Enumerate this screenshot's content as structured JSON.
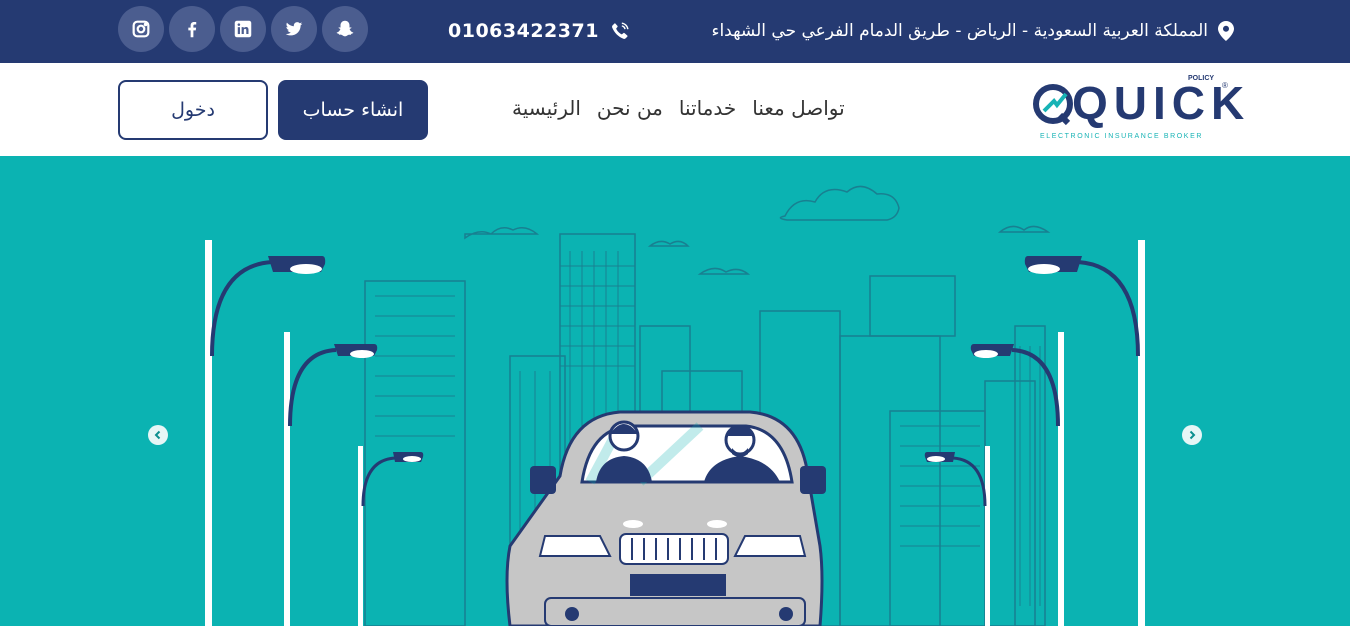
{
  "topbar": {
    "address": "المملكة العربية السعودية - الرياض - طريق الدمام الفرعي حي الشهداء",
    "phone": "01063422371",
    "social": [
      "instagram-icon",
      "facebook-icon",
      "linkedin-icon",
      "twitter-icon",
      "snapchat-icon"
    ]
  },
  "nav": {
    "links": [
      "الرئيسية",
      "من نحن",
      "خدماتنا",
      "تواصل معنا"
    ],
    "signup_label": "انشاء حساب",
    "login_label": "دخول"
  },
  "logo": {
    "word": "QUICK",
    "small": "POLICY",
    "tagline": "ELECTRONIC INSURANCE BROKER"
  },
  "colors": {
    "brand": "#253a72",
    "accent": "#0bb3b2"
  }
}
